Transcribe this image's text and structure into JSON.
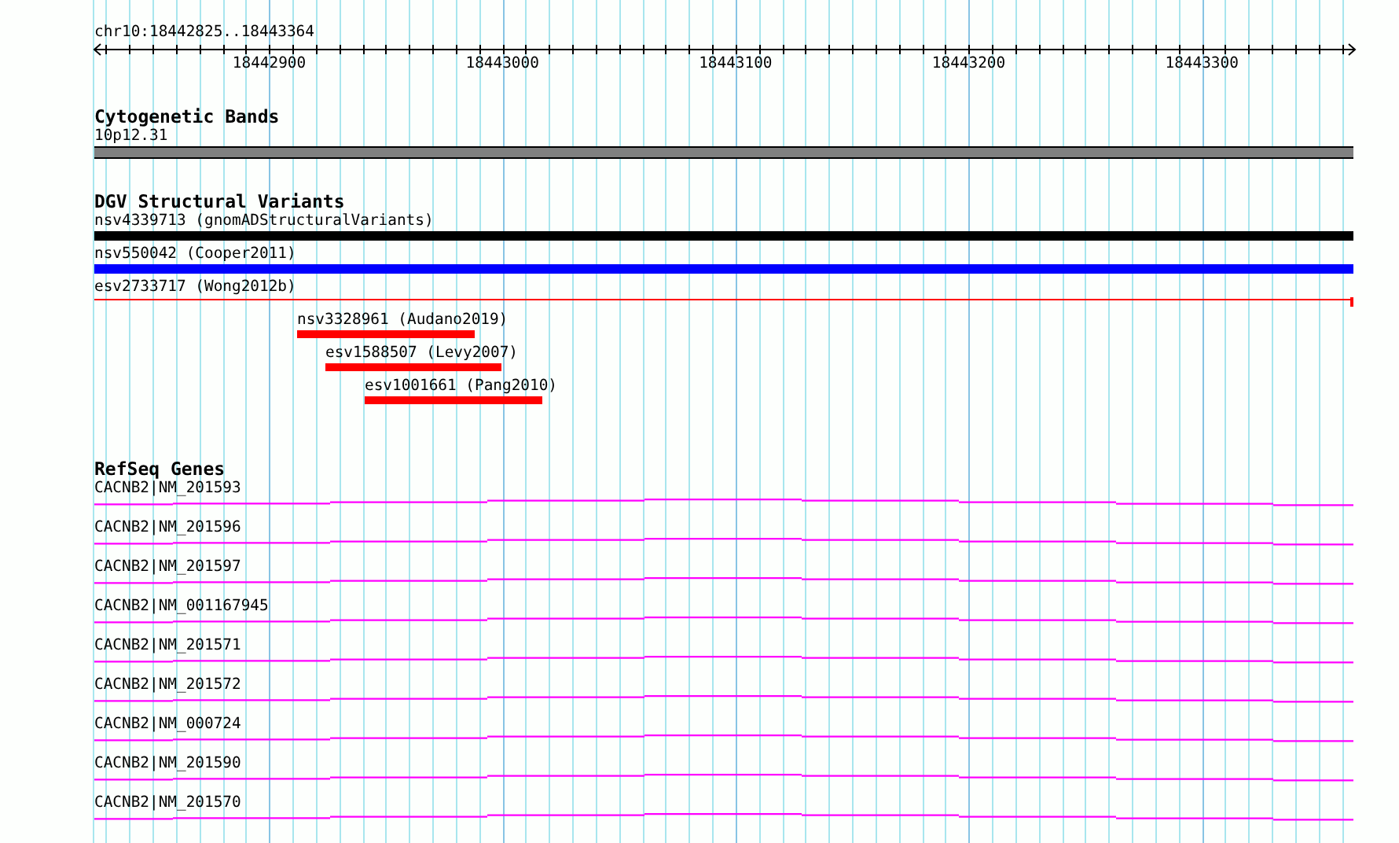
{
  "ruler": {
    "region": "chr10:18442825..18443364",
    "ticks": [
      "18442900",
      "18443000",
      "18443100",
      "18443200",
      "18443300"
    ]
  },
  "tracks": [
    {
      "title": "Cytogenetic Bands",
      "kind": "cytoband",
      "features": [
        {
          "label": "10p12.31"
        }
      ]
    },
    {
      "title": "DGV Structural Variants",
      "kind": "variants",
      "features": [
        {
          "label": "nsv4339713 (gnomADStructuralVariants)",
          "kind": "full",
          "color": "#000000"
        },
        {
          "label": "nsv550042 (Cooper2011)",
          "kind": "full",
          "color": "#0000ff"
        },
        {
          "label": "esv2733717 (Wong2012b)",
          "kind": "line",
          "color": "#ff0000"
        },
        {
          "label": "nsv3328961 (Audano2019)",
          "kind": "partial",
          "color": "#ff0000"
        },
        {
          "label": "esv1588507 (Levy2007)",
          "kind": "partial",
          "color": "#ff0000"
        },
        {
          "label": "esv1001661 (Pang2010)",
          "kind": "partial",
          "color": "#ff0000"
        }
      ]
    },
    {
      "title": "RefSeq Genes",
      "kind": "genes",
      "features": [
        {
          "label": "CACNB2|NM_201593"
        },
        {
          "label": "CACNB2|NM_201596"
        },
        {
          "label": "CACNB2|NM_201597"
        },
        {
          "label": "CACNB2|NM_001167945"
        },
        {
          "label": "CACNB2|NM_201571"
        },
        {
          "label": "CACNB2|NM_201572"
        },
        {
          "label": "CACNB2|NM_000724"
        },
        {
          "label": "CACNB2|NM_201590"
        },
        {
          "label": "CACNB2|NM_201570"
        }
      ]
    }
  ]
}
